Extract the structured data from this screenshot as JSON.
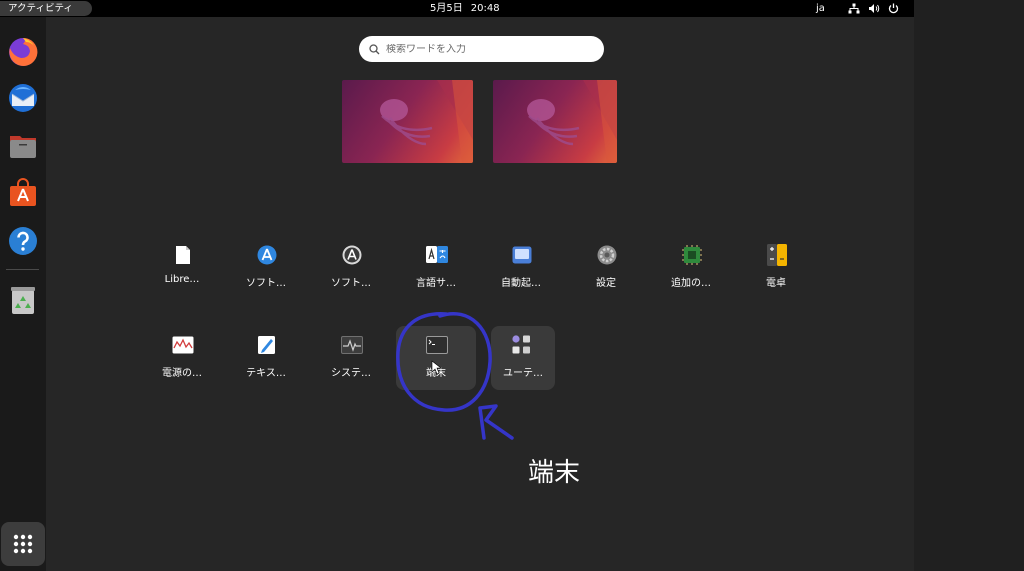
{
  "topbar": {
    "activities_label": "アクティビティ",
    "date": "5月5日",
    "time": "20:48",
    "language": "ja",
    "tray_icons": [
      "network-icon",
      "volume-icon",
      "power-icon"
    ]
  },
  "dock": {
    "items": [
      {
        "name": "firefox",
        "icon": "firefox-icon"
      },
      {
        "name": "thunderbird",
        "icon": "thunderbird-icon"
      },
      {
        "name": "files",
        "icon": "files-icon"
      },
      {
        "name": "app-center",
        "icon": "app-center-icon"
      },
      {
        "name": "help",
        "icon": "help-icon"
      },
      {
        "name": "trash",
        "icon": "trash-icon"
      }
    ],
    "show_apps_icon": "grid-icon"
  },
  "search": {
    "placeholder": "検索ワードを入力",
    "value": ""
  },
  "workspaces": [
    {
      "name": "workspace-1"
    },
    {
      "name": "workspace-2"
    }
  ],
  "apps": {
    "row1": [
      {
        "label": "Libre…",
        "icon": "document-icon"
      },
      {
        "label": "ソフト…",
        "icon": "software-icon"
      },
      {
        "label": "ソフト…",
        "icon": "software-updater-icon"
      },
      {
        "label": "言語サ…",
        "icon": "language-icon"
      },
      {
        "label": "自動起…",
        "icon": "startup-icon"
      },
      {
        "label": "設定",
        "icon": "settings-icon"
      },
      {
        "label": "追加の…",
        "icon": "chip-icon"
      },
      {
        "label": "電卓",
        "icon": "calculator-icon"
      }
    ],
    "row2": [
      {
        "label": "電源の…",
        "icon": "power-stats-icon"
      },
      {
        "label": "テキス…",
        "icon": "text-editor-icon"
      },
      {
        "label": "システ…",
        "icon": "system-monitor-icon"
      },
      {
        "label": "端末",
        "icon": "terminal-icon",
        "selected": true
      },
      {
        "label": "ユーテ…",
        "icon": "utilities-folder-icon",
        "selected": true
      }
    ]
  },
  "annotation": {
    "text": "端末",
    "color": "#3535c8"
  },
  "colors": {
    "background": "#262626",
    "topbar": "#000000",
    "dock": "#1a1a1a",
    "firefox": "#ff7139",
    "app_center": "#e95420",
    "help": "#2a7fd4"
  }
}
